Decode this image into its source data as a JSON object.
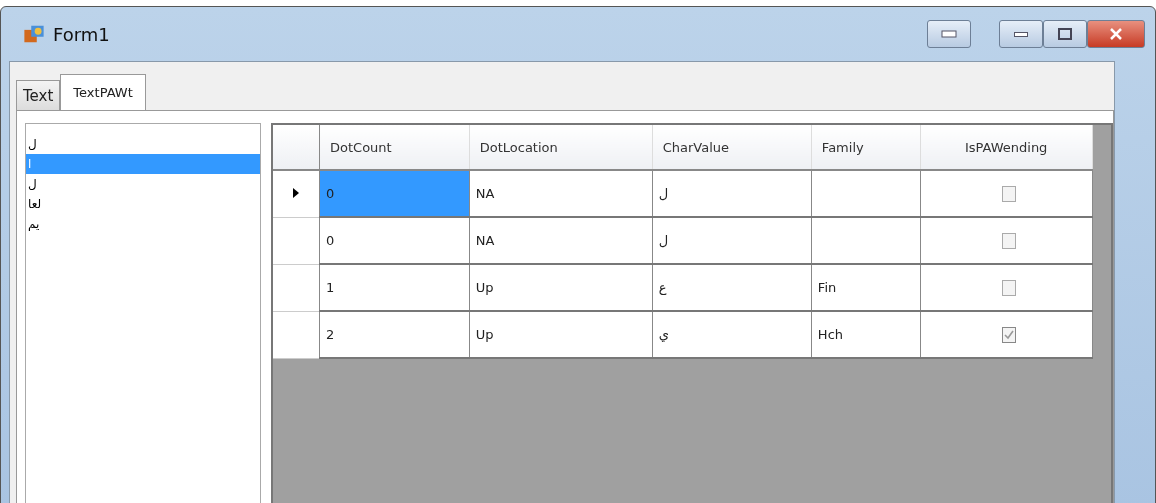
{
  "window": {
    "title": "Form1"
  },
  "tabs": [
    {
      "label": "Text",
      "selected": false
    },
    {
      "label": "TextPAWt",
      "selected": true
    }
  ],
  "list": {
    "items": [
      {
        "text": "ل",
        "selected": false
      },
      {
        "text": "ا",
        "selected": true
      },
      {
        "text": "ل",
        "selected": false
      },
      {
        "text": "لعا",
        "selected": false
      },
      {
        "text": "يم",
        "selected": false
      }
    ]
  },
  "grid": {
    "columns": [
      "DotCount",
      "DotLocation",
      "CharValue",
      "Family",
      "IsPAWending"
    ],
    "rows": [
      {
        "current": true,
        "cells": [
          {
            "text": "0",
            "selected": true
          },
          {
            "text": "NA",
            "selected": false
          },
          {
            "text": "ل",
            "selected": false
          },
          {
            "selected": false
          }
        ],
        "checked": false
      },
      {
        "current": false,
        "cells": [
          {
            "text": "0",
            "selected": false
          },
          {
            "text": "NA",
            "selected": false
          },
          {
            "text": "ل",
            "selected": false
          },
          {
            "selected": false
          }
        ],
        "checked": false
      },
      {
        "current": false,
        "cells": [
          {
            "text": "1",
            "selected": false
          },
          {
            "text": "Up",
            "selected": false
          },
          {
            "text": "ع",
            "selected": false
          },
          {
            "text": "Fin",
            "selected": false
          }
        ],
        "checked": false
      },
      {
        "current": false,
        "cells": [
          {
            "text": "2",
            "selected": false
          },
          {
            "text": "Up",
            "selected": false
          },
          {
            "text": "ي",
            "selected": false
          },
          {
            "text": "Hch",
            "selected": false
          }
        ],
        "checked": true
      }
    ]
  }
}
